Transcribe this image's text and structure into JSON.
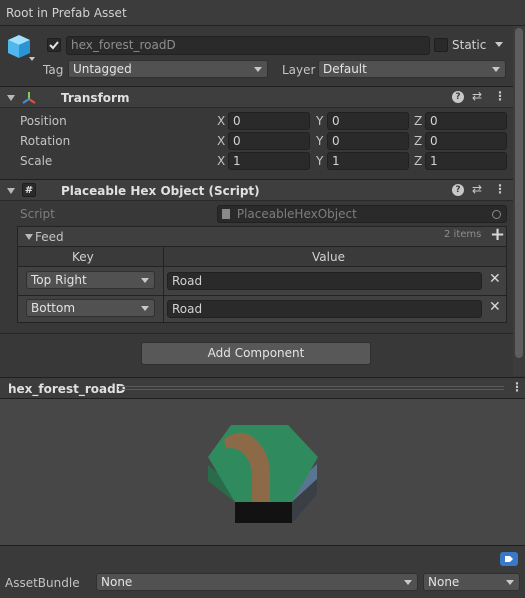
{
  "header": {
    "title": "Root in Prefab Asset"
  },
  "gameobject": {
    "name": "hex_forest_roadD",
    "active_checked": true,
    "static_label": "Static",
    "tag_label": "Tag",
    "tag_value": "Untagged",
    "layer_label": "Layer",
    "layer_value": "Default"
  },
  "transform": {
    "title": "Transform",
    "rows": [
      {
        "label": "Position",
        "x": "0",
        "y": "0",
        "z": "0"
      },
      {
        "label": "Rotation",
        "x": "0",
        "y": "0",
        "z": "0"
      },
      {
        "label": "Scale",
        "x": "1",
        "y": "1",
        "z": "1"
      }
    ],
    "axes": {
      "x": "X",
      "y": "Y",
      "z": "Z"
    }
  },
  "script_component": {
    "title": "Placeable Hex Object (Script)",
    "script_label": "Script",
    "script_value": "PlaceableHexObject",
    "feed_label": "Feed",
    "feed_count": "2 items",
    "col_key": "Key",
    "col_value": "Value",
    "entries": [
      {
        "key": "Top Right",
        "value": "Road"
      },
      {
        "key": "Bottom",
        "value": "Road"
      }
    ]
  },
  "add_component": "Add Component",
  "preview": {
    "title": "hex_forest_roadD"
  },
  "assetbundle": {
    "label": "AssetBundle",
    "name": "None",
    "variant": "None"
  },
  "icons": {
    "cube": "cube-icon",
    "transform": "transform-axes-icon",
    "script": "script-hash-icon",
    "help": "help-icon",
    "presets": "presets-icon",
    "more": "kebab-menu-icon",
    "add": "plus-icon",
    "remove": "close-icon",
    "label": "label-tag-icon",
    "target": "object-picker-icon"
  },
  "colors": {
    "background": "#383838",
    "field": "#2a2a2a",
    "hex_green": "#2f8a5e",
    "road": "#8c6a47",
    "hex_base": "#141414",
    "label_icon": "#3a78c8"
  }
}
